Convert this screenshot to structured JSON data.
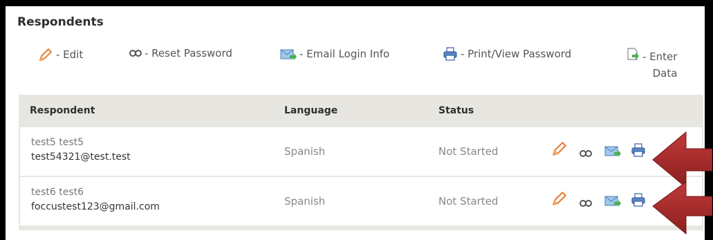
{
  "section": {
    "title": "Respondents"
  },
  "legend": {
    "edit": "- Edit",
    "reset_password": "- Reset Password",
    "email_login": "- Email Login Info",
    "print_password": "- Print/View Password",
    "enter_data_line1": "- Enter",
    "enter_data_line2": "Data"
  },
  "table": {
    "headers": {
      "respondent": "Respondent",
      "language": "Language",
      "status": "Status"
    },
    "rows": [
      {
        "name": "test5 test5",
        "email": "test54321@test.test",
        "language": "Spanish",
        "status": "Not Started"
      },
      {
        "name": "test6 test6",
        "email": "foccustest123@gmail.com",
        "language": "Spanish",
        "status": "Not Started"
      }
    ]
  },
  "icons": {
    "edit": "pencil-icon",
    "reset": "link-icon",
    "email": "email-icon",
    "print": "printer-icon",
    "enter": "enter-data-icon"
  },
  "colors": {
    "accent_arrow": "#a82a2a",
    "pencil": "#e8803a",
    "header_bg": "#e8e6e1"
  }
}
